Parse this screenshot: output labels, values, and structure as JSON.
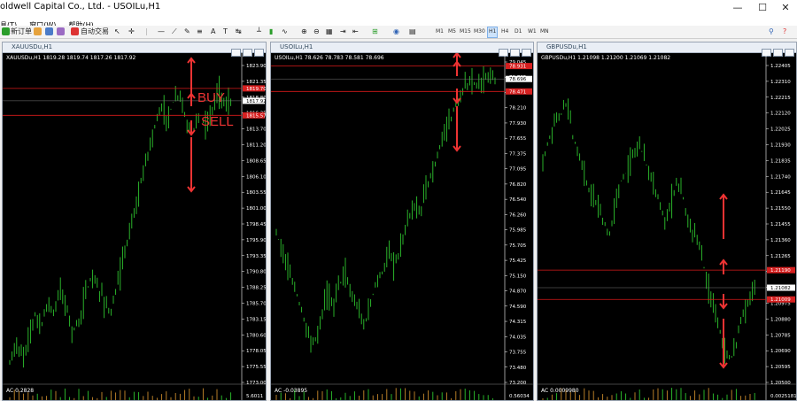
{
  "app": {
    "title": "oldwell Capital Co., Ltd. - USOILu,H1",
    "min": "—",
    "max": "☐",
    "close": "✕"
  },
  "menu": [
    "具(T)",
    "窗口(W)",
    "帮助(H)"
  ],
  "toolbar": {
    "new_order": "新订单",
    "auto_trade": "自动交易",
    "timeframes": [
      "M1",
      "M5",
      "M15",
      "M30",
      "H1",
      "H4",
      "D1",
      "W1",
      "MN"
    ],
    "selected_tf": "H1"
  },
  "colors": {
    "bg": "#000000",
    "candle": "#2ec52e",
    "line": "#d91a1a",
    "annot": "#ee3333",
    "axis": "#ffffff"
  },
  "charts": [
    {
      "id": "xau",
      "title": "XAUUSDu,H1",
      "ohlc": "XAUUSDu,H1  1819.28 1819.74 1817.26 1817.92",
      "ticks": [
        "1823.90",
        "1821.35",
        "1818.80",
        "1816.25",
        "1813.70",
        "1811.20",
        "1808.65",
        "1806.10",
        "1803.55",
        "1801.00",
        "1798.45",
        "1795.90",
        "1793.35",
        "1790.80",
        "1788.25",
        "1785.70",
        "1783.15",
        "1780.60",
        "1778.05",
        "1775.55",
        "1773.00"
      ],
      "min": 1773.0,
      "max": 1824.4,
      "hlines": [
        1819.9,
        1815.6
      ],
      "hline_labels": [
        "1819.70",
        "1815.57"
      ],
      "price_tag": "1817.92",
      "price": 1817.92,
      "ac_label": "AC 0.2828",
      "ac_tick": "5.6011",
      "series": [
        1776,
        1779,
        1777,
        1780,
        1784,
        1782,
        1786,
        1784,
        1788,
        1785,
        1781,
        1783,
        1787,
        1790,
        1788,
        1786,
        1784,
        1788,
        1793,
        1797,
        1801,
        1806,
        1810,
        1814,
        1817,
        1815,
        1818,
        1819,
        1814,
        1813,
        1816,
        1814,
        1816,
        1820,
        1817,
        1818
      ],
      "annotations": {
        "buy": "BUY",
        "sell": "SELL"
      }
    },
    {
      "id": "usoil",
      "title": "USOILu,H1",
      "ohlc": "USOILu,H1  78.626 78.783 78.581 78.696",
      "ticks": [
        "79.045",
        "78.765",
        "78.490",
        "78.210",
        "77.930",
        "77.655",
        "77.375",
        "77.095",
        "76.820",
        "76.540",
        "76.260",
        "75.985",
        "75.705",
        "75.425",
        "75.150",
        "74.870",
        "74.590",
        "74.315",
        "74.035",
        "73.755",
        "73.480",
        "73.200"
      ],
      "min": 73.2,
      "max": 79.1,
      "hlines": [
        78.93,
        78.47
      ],
      "hline_labels": [
        "78.931",
        "78.471"
      ],
      "price_tag": "78.696",
      "price": 78.696,
      "ac_label": "AC -0.03895",
      "ac_tick": "0.56034",
      "series": [
        75.9,
        75.6,
        75.2,
        74.9,
        74.5,
        74.2,
        73.9,
        74.3,
        74.8,
        74.6,
        74.9,
        75.2,
        74.8,
        74.6,
        74.2,
        74.6,
        75.0,
        75.2,
        75.6,
        75.3,
        75.7,
        76.1,
        76.4,
        76.3,
        76.7,
        77.0,
        77.4,
        77.8,
        78.0,
        78.3,
        78.5,
        78.7,
        78.6,
        78.7,
        78.7,
        78.7
      ]
    },
    {
      "id": "gbp",
      "title": "GBPUSDu,H1",
      "ohlc": "GBPUSDu,H1  1.21098 1.21200 1.21069 1.21082",
      "ticks": [
        "1.22405",
        "1.22310",
        "1.22215",
        "1.22120",
        "1.22025",
        "1.21930",
        "1.21835",
        "1.21740",
        "1.21645",
        "1.21550",
        "1.21455",
        "1.21360",
        "1.21265",
        "1.21165",
        "1.21070",
        "1.20975",
        "1.20880",
        "1.20785",
        "1.20690",
        "1.20595",
        "1.20500"
      ],
      "min": 1.205,
      "max": 1.2248,
      "hlines": [
        1.2119,
        1.2101
      ],
      "hline_labels": [
        "1.21190",
        "1.21009"
      ],
      "price_tag": "1.21082",
      "price": 1.21082,
      "ac_label": "AC 0.0009980",
      "ac_tick": "0.0025181",
      "series": [
        1.2185,
        1.22,
        1.221,
        1.2215,
        1.2222,
        1.22,
        1.219,
        1.2175,
        1.2165,
        1.216,
        1.215,
        1.214,
        1.2158,
        1.2175,
        1.218,
        1.219,
        1.2196,
        1.2185,
        1.2172,
        1.2165,
        1.215,
        1.2158,
        1.2172,
        1.2168,
        1.2145,
        1.214,
        1.2135,
        1.2112,
        1.21,
        1.2085,
        1.207,
        1.2064,
        1.2075,
        1.2092,
        1.2102,
        1.2108
      ]
    }
  ]
}
